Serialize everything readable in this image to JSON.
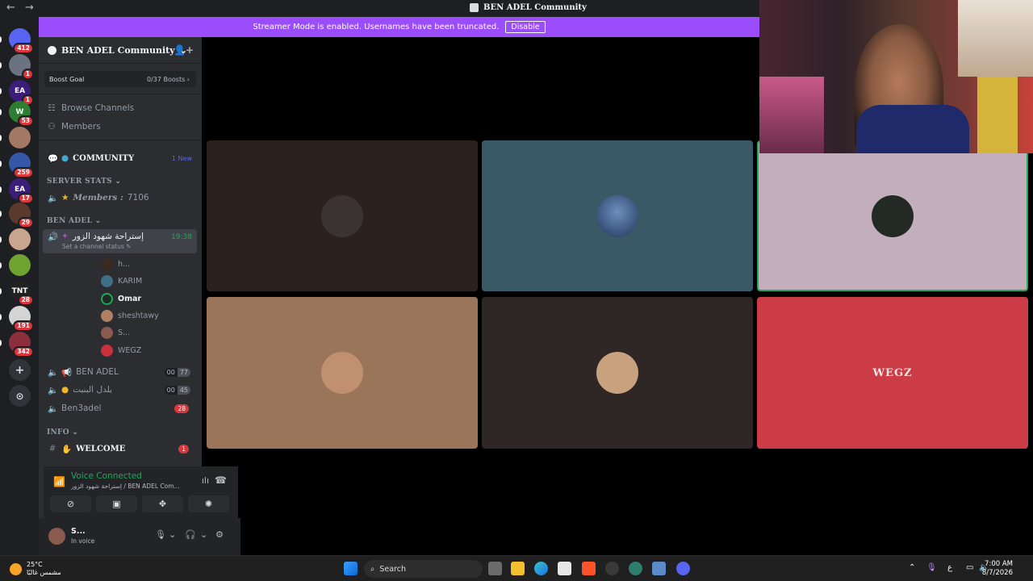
{
  "window": {
    "title": "BEN ADEL Community",
    "nav_arrows": "← →"
  },
  "banner": {
    "message": "Streamer Mode is enabled. Usernames have been truncated.",
    "button": "Disable"
  },
  "rail": {
    "servers": [
      {
        "name": "direct-messages",
        "label": "",
        "badge": "412",
        "color": "#5865f2"
      },
      {
        "name": "server-1",
        "label": "",
        "badge": "1",
        "color": "#6b7280"
      },
      {
        "name": "server-ea-1",
        "label": "EA",
        "badge": "1",
        "color": "#3b1d7a"
      },
      {
        "name": "server-w",
        "label": "W",
        "badge": "53",
        "color": "#2e7d32"
      },
      {
        "name": "server-5",
        "label": "",
        "badge": "",
        "color": "#a47964"
      },
      {
        "name": "server-6",
        "label": "",
        "badge": "259",
        "color": "#3557a8"
      },
      {
        "name": "server-ea-2",
        "label": "EA",
        "badge": "17",
        "color": "#3b1d7a"
      },
      {
        "name": "server-8",
        "label": "",
        "badge": "29",
        "color": "#5b3a2e"
      },
      {
        "name": "server-9",
        "label": "",
        "badge": "",
        "color": "#c9a48f"
      },
      {
        "name": "server-10",
        "label": "",
        "badge": "",
        "color": "#6ea32f"
      },
      {
        "name": "server-tnt",
        "label": "TNT",
        "badge": "28",
        "color": "#222222"
      },
      {
        "name": "server-ben-adel",
        "label": "",
        "badge": "191",
        "color": "#d4d4d4"
      },
      {
        "name": "server-13",
        "label": "",
        "badge": "342",
        "color": "#8a2f3b"
      }
    ],
    "add_label": "+",
    "discover_label": "⊙"
  },
  "sidebar": {
    "guild_name": "BEN ADEL Community",
    "boost": {
      "label": "Boost Goal",
      "count": "0/37 Boosts ›"
    },
    "nav": [
      {
        "name": "browse-channels",
        "label": "Browse Channels",
        "icon": "grid-icon"
      },
      {
        "name": "members",
        "label": "Members",
        "icon": "members-icon"
      }
    ],
    "community": {
      "label": "COMMUNITY",
      "badge": "1 New"
    },
    "server_stats": {
      "label": "SERVER STATS ⌄",
      "members_label": "Members :",
      "members_count": "7106"
    },
    "ben_adel_cat": "BEN ADEL ⌄",
    "active_channel": {
      "label": "إستراحة شهود الزور",
      "time": "19:38",
      "sub": "Set a channel status ✎"
    },
    "voice_users": [
      {
        "name": "h...",
        "color": "#3a2a22",
        "highlight": false
      },
      {
        "name": "KARIM",
        "color": "#3f6f86",
        "highlight": false
      },
      {
        "name": "Omar",
        "color": "#1d2b24",
        "highlight": true
      },
      {
        "name": "sheshtawy",
        "color": "#b08060",
        "highlight": false
      },
      {
        "name": "S...",
        "color": "#8a5a4e",
        "highlight": false
      },
      {
        "name": "WEGZ",
        "color": "#c8303c",
        "highlight": false
      }
    ],
    "channels": [
      {
        "name": "ben-adel-voice",
        "label": "BEN ADEL",
        "c1": "00",
        "c2": "77"
      },
      {
        "name": "arabic-voice",
        "label": "بلدل البنبت",
        "c1": "00",
        "c2": "45"
      },
      {
        "name": "ben3adel",
        "label": "Ben3adel",
        "badge": "28"
      }
    ],
    "info_cat": "INFO ⌄",
    "welcome": {
      "label": "WELCOME",
      "badge": "1"
    }
  },
  "voice_panel": {
    "status": "Voice Connected",
    "location": "إستراحة شهود الزور / BEN ADEL Com..."
  },
  "user_panel": {
    "name": "S...",
    "status": "In voice"
  },
  "tiles": [
    {
      "name": "tile-user-1",
      "bg": "#2b221d",
      "avatar": "#3b3432",
      "speaking": false
    },
    {
      "name": "tile-user-2",
      "bg": "#3a5967",
      "avatar": "#2e4c72",
      "speaking": false
    },
    {
      "name": "tile-user-3",
      "bg": "#c3afbb",
      "avatar": "#232a26",
      "speaking": true
    },
    {
      "name": "tile-user-4",
      "bg": "#9b7559",
      "avatar": "#b58a6a",
      "speaking": false
    },
    {
      "name": "tile-user-5",
      "bg": "#2f2626",
      "avatar": "#c8a27f",
      "speaking": false
    },
    {
      "name": "tile-wegz",
      "bg": "#cb3c46",
      "avatar": "#cb3c46",
      "speaking": false,
      "logo": "WEGZ"
    }
  ],
  "taskbar": {
    "temp": "25°C",
    "weather_desc": "مشمس غالبًا",
    "search": "Search",
    "time": "7:00 AM",
    "date": "8/7/2026",
    "lang": "ع"
  }
}
